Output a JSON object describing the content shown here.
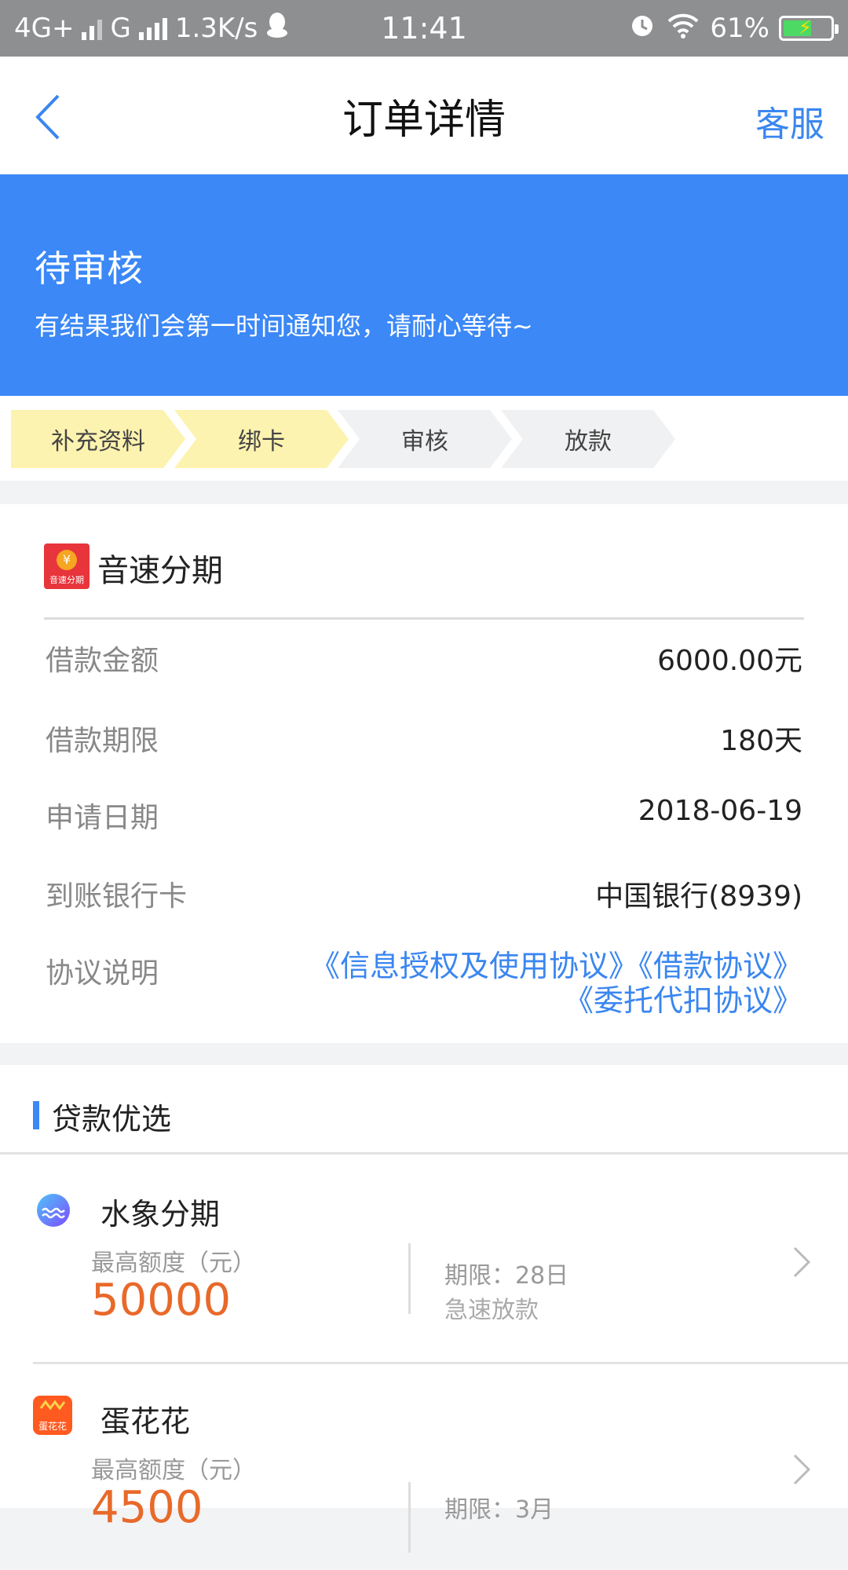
{
  "status_bar": {
    "network1": "4G+",
    "network2": "G",
    "speed": "1.3K/s",
    "time": "11:41",
    "battery": "61%",
    "battery_level": 0.61
  },
  "nav": {
    "title": "订单详情",
    "service": "客服"
  },
  "banner": {
    "title": "待审核",
    "subtitle": "有结果我们会第一时间通知您，请耐心等待~",
    "color": "#3b88f6"
  },
  "steps": [
    {
      "label": "补充资料",
      "state": "done"
    },
    {
      "label": "绑卡",
      "state": "done"
    },
    {
      "label": "审核",
      "state": "pending"
    },
    {
      "label": "放款",
      "state": "pending"
    }
  ],
  "order": {
    "product_logo_text": "音速分期",
    "product_name": "音速分期",
    "rows": [
      {
        "label": "借款金额",
        "value": "6000.00元"
      },
      {
        "label": "借款期限",
        "value": "180天"
      },
      {
        "label": "申请日期",
        "value": "2018-06-19"
      },
      {
        "label": "到账银行卡",
        "value": "中国银行(8939)"
      }
    ],
    "agreement_label": "协议说明",
    "agreement_line1": "《信息授权及使用协议》《借款协议》",
    "agreement_line2": "《委托代扣协议》"
  },
  "loans": {
    "section_title": "贷款优选",
    "items": [
      {
        "name": "水象分期",
        "quota_label": "最高额度（元）",
        "quota": "50000",
        "term": "期限：28日",
        "feature": "急速放款",
        "icon": "water-wave-icon"
      },
      {
        "name": "蛋花花",
        "logo_text": "蛋花花",
        "quota_label": "最高额度（元）",
        "quota": "4500",
        "term": "期限：3月",
        "feature": "",
        "icon": "danhuahua-logo-icon"
      }
    ]
  }
}
